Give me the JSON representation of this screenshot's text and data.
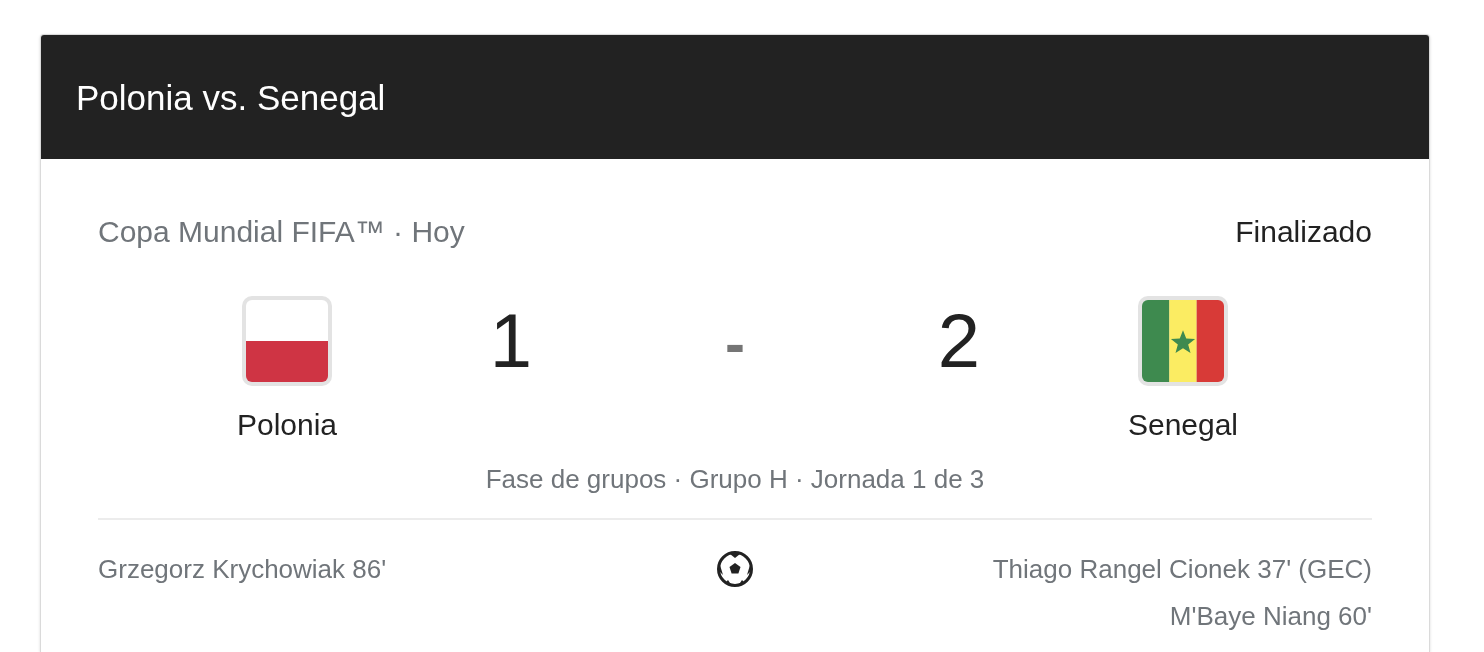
{
  "header": {
    "title": "Polonia vs. Senegal"
  },
  "match": {
    "competition": "Copa Mundial FIFA™ · Hoy",
    "status": "Finalizado"
  },
  "teams": [
    {
      "name": "Polonia",
      "kind": "poland"
    },
    {
      "name": "Senegal",
      "kind": "senegal"
    }
  ],
  "score": {
    "home": "1",
    "separator": "-",
    "away": "2"
  },
  "stage": "Fase de grupos · Grupo H · Jornada 1 de 3",
  "goals": {
    "home": [
      "Grzegorz Krychowiak 86'"
    ],
    "away": [
      "Thiago Rangel Cionek 37' (GEC)",
      "M'Baye Niang 60'"
    ]
  }
}
